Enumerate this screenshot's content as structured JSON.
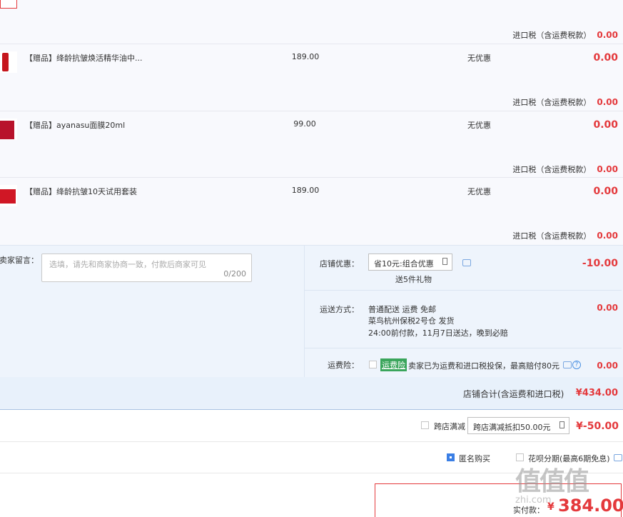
{
  "items": [
    {
      "name": "【赠品】绛龄抗皱焕活精华油中...",
      "price": "189.00",
      "discount": "无优惠",
      "amount": "0.00",
      "tax_label": "进口税（含运费税款）",
      "tax_value": "0.00"
    },
    {
      "name": "【赠品】ayanasu面膜20ml",
      "price": "99.00",
      "discount": "无优惠",
      "amount": "0.00",
      "tax_label": "进口税（含运费税款）",
      "tax_value": "0.00"
    },
    {
      "name": "【赠品】绛龄抗皱10天试用套装",
      "price": "189.00",
      "discount": "无优惠",
      "amount": "0.00",
      "tax_label": "进口税（含运费税款）",
      "tax_value": "0.00"
    }
  ],
  "top_tax": {
    "label": "进口税（含运费税款）",
    "value": "0.00"
  },
  "message": {
    "label": "给卖家留言：",
    "placeholder": "选填，请先和商家协商一致，付款后商家可见",
    "counter": "0/200"
  },
  "store_discount": {
    "label": "店铺优惠：",
    "selected": "省10元:组合优惠",
    "gift": "送5件礼物",
    "amount": "-10.00"
  },
  "shipping": {
    "label": "运送方式：",
    "line1": "普通配送 运费 免邮",
    "line2": "菜鸟杭州保税2号仓   发货",
    "line3": "24:00前付款，11月7日送达，晚到必赔",
    "amount": "0.00"
  },
  "insurance": {
    "label": "运费险：",
    "tag": "运费险",
    "text": "卖家已为运费和进口税投保，最高赔付80元",
    "amount": "0.00"
  },
  "store_total": {
    "label": "店铺合计(含运费和进口税)",
    "value": "¥434.00"
  },
  "cross_store": {
    "label": "跨店满减",
    "selected": "跨店满减抵扣50.00元",
    "amount": "¥-50.00"
  },
  "options": {
    "anonymous": "匿名购买",
    "huabei": "花呗分期(最高6期免息)"
  },
  "payment": {
    "label": "实付款：",
    "currency": "¥",
    "value": "384.00"
  },
  "watermark": {
    "logo": "值值值",
    "site": "zhi.com"
  },
  "colors": {
    "accent_red": "#e4393c",
    "panel_blue": "#eef4fc",
    "insurance_green": "#3aa55b"
  }
}
